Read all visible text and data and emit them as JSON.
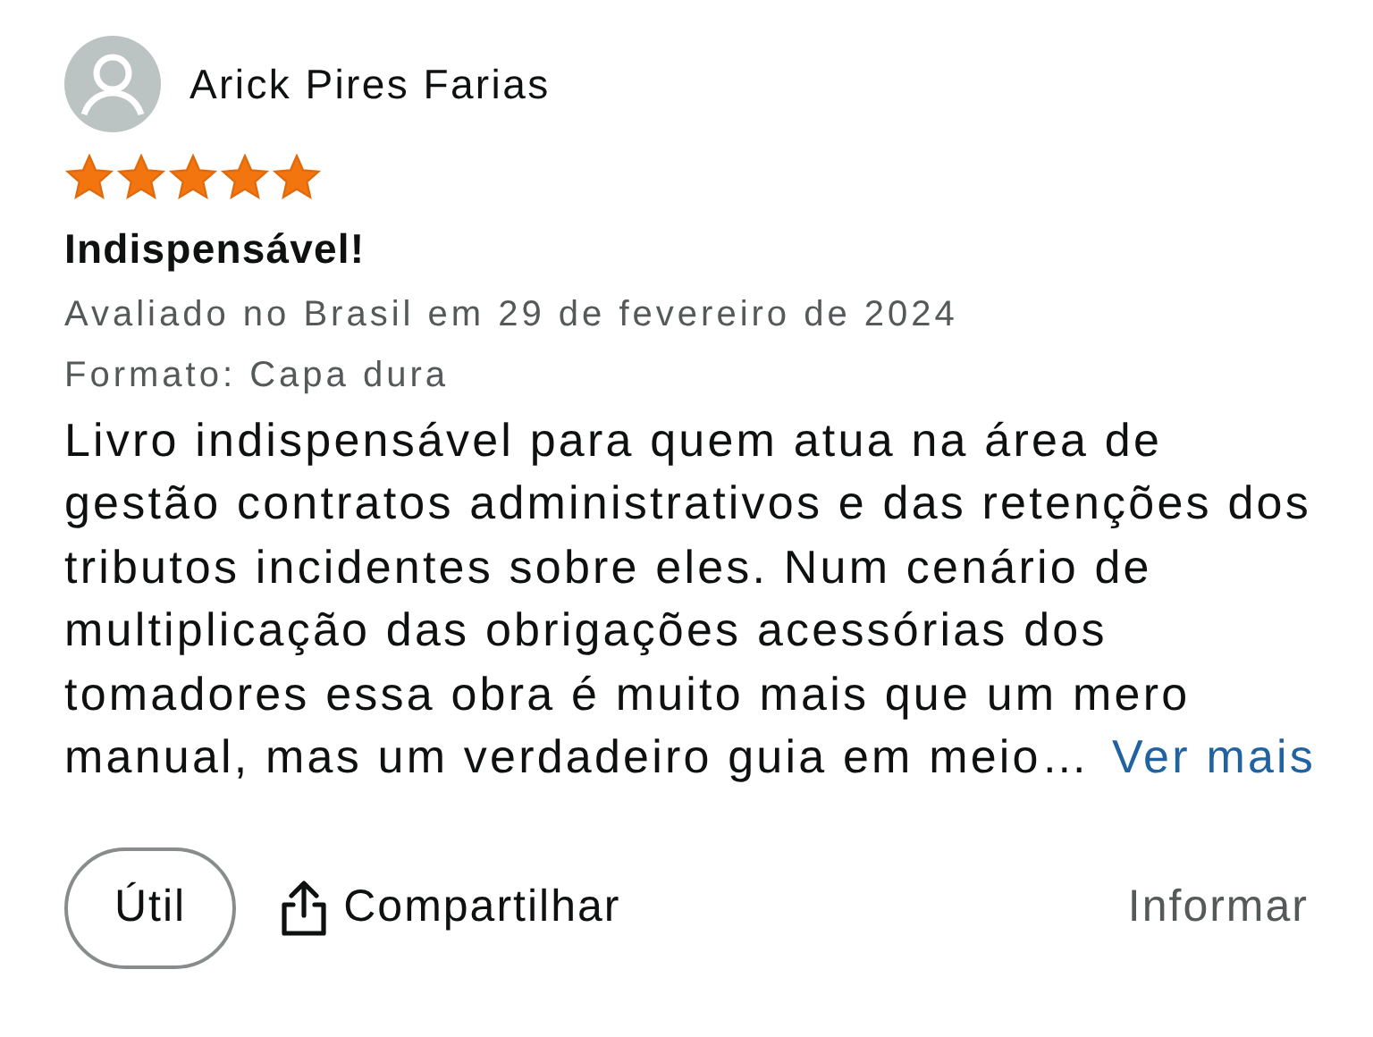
{
  "reviewer": {
    "name": "Arick Pires Farias"
  },
  "rating": {
    "stars": 5
  },
  "title": "Indispensável!",
  "meta": "Avaliado no Brasil em 29 de fevereiro de 2024",
  "format": "Formato: Capa dura",
  "body": "Livro indispensável para quem atua na área de gestão contratos administrativos e das retenções dos tributos incidentes sobre eles. Num cenário de multiplicação das obrigações acessórias dos tomadores essa obra é muito mais que um mero manual, mas um verdadeiro guia em meio…",
  "more_link": "Ver mais",
  "actions": {
    "helpful": "Útil",
    "share": "Compartilhar",
    "report": "Informar"
  }
}
